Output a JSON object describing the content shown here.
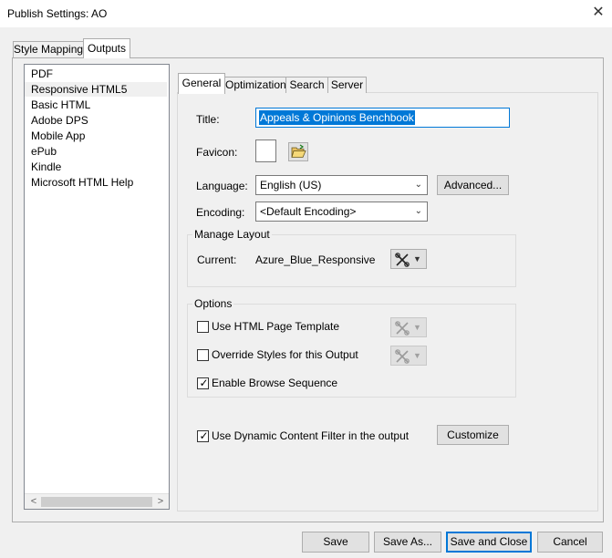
{
  "window": {
    "title": "Publish Settings: AO",
    "close": "✕"
  },
  "outer_tabs": [
    {
      "label": "Style Mapping",
      "active": false
    },
    {
      "label": "Outputs",
      "active": true
    }
  ],
  "outputs_list": {
    "items": [
      "PDF",
      "Responsive HTML5",
      "Basic HTML",
      "Adobe DPS",
      "Mobile App",
      "ePub",
      "Kindle",
      "Microsoft HTML Help"
    ],
    "selected": "Responsive HTML5",
    "scroll_left": "<",
    "scroll_right": ">"
  },
  "inner_tabs": [
    {
      "label": "General",
      "active": true
    },
    {
      "label": "Optimization",
      "active": false
    },
    {
      "label": "Search",
      "active": false
    },
    {
      "label": "Server",
      "active": false
    }
  ],
  "general": {
    "title_label": "Title:",
    "title_value": "Appeals & Opinions Benchbook",
    "favicon_label": "Favicon:",
    "folder_icon": "folder-open-icon",
    "language_label": "Language:",
    "language_value": "English (US)",
    "advanced_button": "Advanced...",
    "encoding_label": "Encoding:",
    "encoding_value": "<Default Encoding>",
    "manage_layout": {
      "group_title": "Manage Layout",
      "current_label": "Current:",
      "current_value": "Azure_Blue_Responsive",
      "tools_icon": "tools-icon"
    },
    "options": {
      "group_title": "Options",
      "use_html_template": {
        "label": "Use HTML Page Template",
        "checked": false
      },
      "override_styles": {
        "label": "Override Styles for this Output",
        "checked": false
      },
      "enable_browse_sequence": {
        "label": "Enable Browse Sequence",
        "checked": true
      }
    },
    "dynamic_filter": {
      "label": "Use Dynamic Content Filter in the output",
      "checked": true
    },
    "customize_button": "Customize"
  },
  "footer": {
    "save": "Save",
    "save_as": "Save As...",
    "save_and_close": "Save and Close",
    "cancel": "Cancel"
  },
  "colors": {
    "accent": "#0078d7",
    "window_bg": "#f0f0f0"
  }
}
